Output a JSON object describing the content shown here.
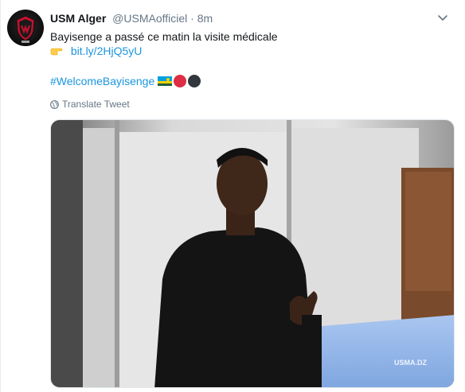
{
  "tweet": {
    "author_name": "USM Alger",
    "author_handle": "@USMAofficiel",
    "separator": "·",
    "time": "8m",
    "text": "Bayisenge a passé ce matin la visite médicale",
    "link": "bit.ly/2HjQ5yU",
    "hashtag": "#WelcomeBayisenge",
    "translate_label": "Translate Tweet"
  },
  "media": {
    "watermark": "USMA.DZ"
  },
  "icons": {
    "pointing_hand": "backhand-index-pointing-right",
    "flag": "flag-rwanda",
    "red_circle": "red-circle",
    "black_circle": "black-circle",
    "caret": "chevron-down-icon",
    "globe": "globe-icon"
  },
  "colors": {
    "link": "#1b95e0",
    "muted": "#657786",
    "text": "#14171a"
  }
}
